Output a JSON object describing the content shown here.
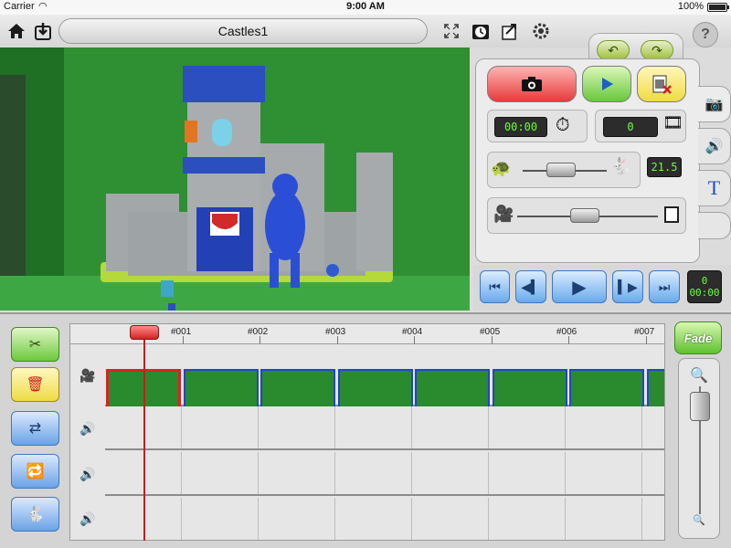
{
  "status": {
    "carrier": "Carrier",
    "time": "9:00 AM",
    "battery": "100%"
  },
  "toolbar": {
    "title": "Castles1"
  },
  "controls": {
    "timer_display": "00:00",
    "frame_count": "0",
    "speed_value": "21.5",
    "transport_frame": "0",
    "transport_time": "00:00"
  },
  "timeline": {
    "markers": [
      "#001",
      "#002",
      "#003",
      "#004",
      "#005",
      "#006",
      "#007"
    ],
    "fade_label": "Fade"
  },
  "colors": {
    "record": "#e63b3b",
    "play": "#66c83a",
    "delete": "#efdb42",
    "lcd_text": "#6cff3b",
    "selection": "#d62424",
    "frame_border": "#2244cc"
  }
}
